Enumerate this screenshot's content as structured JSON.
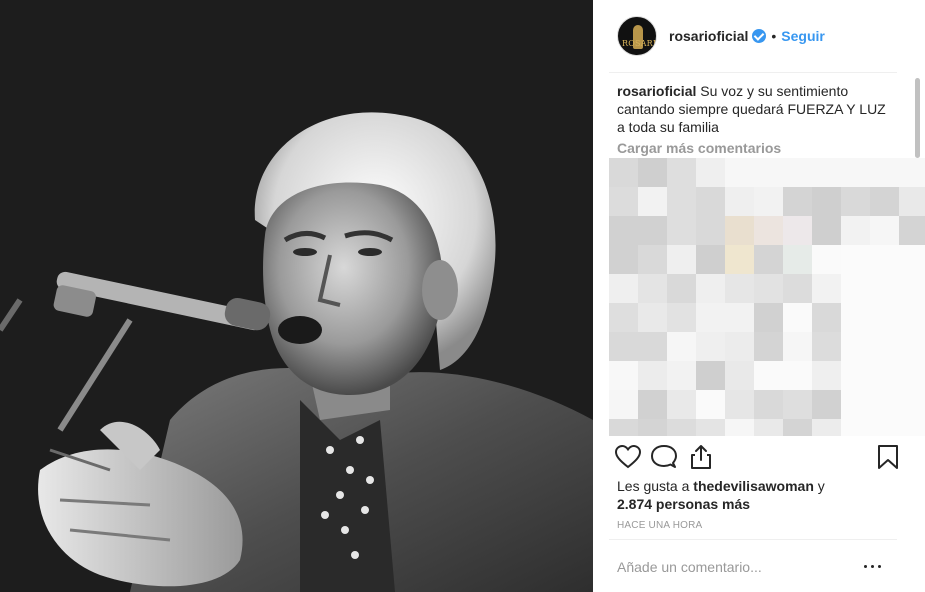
{
  "post": {
    "photo_alt": "",
    "author": "rosarioficial",
    "verified": true,
    "separator": "•",
    "follow_label": "Seguir",
    "avatar_text": "ROSARIO"
  },
  "caption": {
    "author": "rosarioficial",
    "text": "Su voz y su sentimiento cantando siempre quedará FUERZA Y LUZ a toda su familia"
  },
  "comments": {
    "load_more": "Cargar más comentarios"
  },
  "likes": {
    "prefix": "Les gusta a",
    "liker": "thedevilisawoman",
    "connector": "y",
    "count_text": "2.874 personas más"
  },
  "timestamp": "HACE UNA HORA",
  "add_comment": {
    "placeholder": "Añade un comentario..."
  },
  "icons": {
    "like": "heart-icon",
    "comment": "comment-icon",
    "share": "share-icon",
    "save": "bookmark-icon",
    "more": "more-options-icon"
  },
  "colors": {
    "accent": "#3897f0",
    "text": "#262626",
    "muted": "#999999",
    "photo_bg": "#1d1d1d"
  }
}
